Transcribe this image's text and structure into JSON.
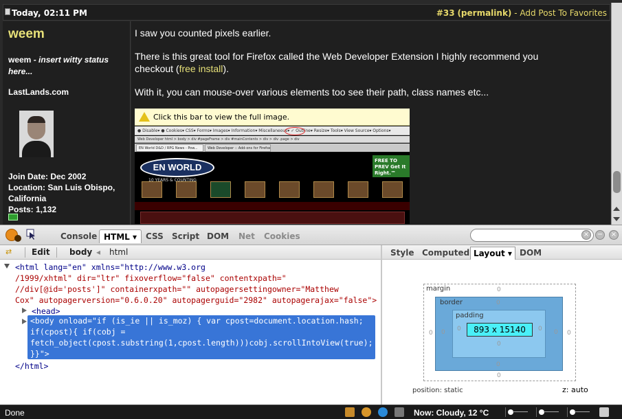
{
  "post": {
    "date": "Today, 02:11 PM",
    "number": "#33",
    "permalink": "(permalink)",
    "sep": " - ",
    "favorites": "Add Post To Favorites",
    "paragraphs": [
      "I saw you counted pixels earlier.",
      "There is this great tool for Firefox called the Web Developer Extension I highly recommend you",
      "With it, you can mouse-over various elements too see their path, class names etc..."
    ],
    "p2_line2_prefix": "checkout (",
    "p2_link": "free install",
    "p2_line2_suffix": ")."
  },
  "user": {
    "name": "weem",
    "status_name": "weem",
    "status_text": " - insert witty status here...",
    "site": "LastLands.com",
    "join": "Join Date: Dec 2002",
    "location_line1": "Location: San Luis Obispo,",
    "location_line2": "California",
    "posts": "Posts: 1,132"
  },
  "embedded": {
    "bar_text": "Click this bar to view the full image.",
    "toolbar": "● Disable▾  ● Cookies▾  CSS▾  Forms▾  Images▾  Information▾  Miscellaneous▾  ✓ Outline▾  Resize▾  Tools▾  View Source▾  Options▾",
    "toolbar2": "Web Developer   html > body > div #pageFrame > div #mainContents > div > div .page > div",
    "tab1": "EN World D&D / RPG News - Pow...",
    "tab2": "Web Developer :: Add-ons for Firefox",
    "logo": "EN WORLD",
    "logo_sub": "10 YEARS & COUNTING",
    "ad": "FREE TO PREV Get It Right.™"
  },
  "firebug": {
    "tabs": [
      "Console",
      "HTML",
      "CSS",
      "Script",
      "DOM",
      "Net",
      "Cookies"
    ],
    "html_tab_arrow": "▾",
    "edit": "Edit",
    "crumbs": [
      "body",
      "html"
    ],
    "crumb_arrow": "◂",
    "side_tabs": [
      "Style",
      "Computed",
      "Layout",
      "DOM"
    ],
    "layout_arrow": "▾",
    "code": {
      "l1": "<html lang=\"en\" xmlns=\"http://www.w3.org",
      "l2": "/1999/xhtml\" dir=\"ltr\" fixoverflow=\"false\" contentxpath=\"",
      "l3": "//div[@id='posts']\" containerxpath=\"\" autopagersettingowner=\"Matthew",
      "l4": "Cox\" autopagerversion=\"0.6.0.20\" autopagerguid=\"2982\" autopagerajax=\"false\">",
      "l5": "<head>",
      "l6": "<body onload=\"if (is_ie || is_moz) { var cpost=document.location.hash;",
      "l7": "if(cpost){ if(cobj =",
      "l8": "fetch_object(cpost.substring(1,cpost.length)))cobj.scrollIntoView(true);",
      "l9": "}}\">",
      "l10": "</html>"
    },
    "layout": {
      "margin_label": "margin",
      "border_label": "border",
      "padding_label": "padding",
      "size": "893 x 15140",
      "zero": "0",
      "position": "position: static",
      "z": "z: auto"
    }
  },
  "statusbar": {
    "done": "Done",
    "weather": "Now: Cloudy, 12 °C"
  }
}
